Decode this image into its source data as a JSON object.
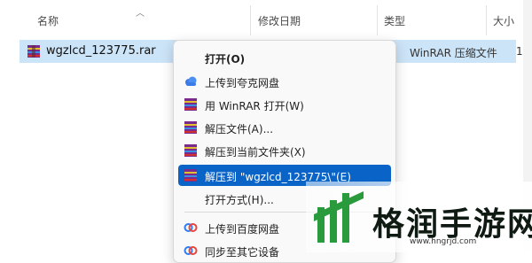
{
  "header": {
    "columns": [
      "名称",
      "修改日期",
      "类型",
      "大小"
    ]
  },
  "file": {
    "name": "wgzlcd_123775.rar",
    "type": "WinRAR 压缩文件",
    "size_fragment": "1"
  },
  "context_menu": {
    "items": [
      {
        "label": "打开(O)",
        "icon": "none"
      },
      {
        "label": "上传到夸克网盘",
        "icon": "cloud-icon"
      },
      {
        "label": "用 WinRAR 打开(W)",
        "icon": "winrar-icon"
      },
      {
        "label": "解压文件(A)...",
        "icon": "winrar-icon"
      },
      {
        "label": "解压到当前文件夹(X)",
        "icon": "winrar-icon"
      },
      {
        "label": "解压到 \"wgzlcd_123775\\\"(E)",
        "icon": "winrar-icon",
        "highlighted": true
      },
      {
        "label": "打开方式(H)...",
        "icon": "none"
      },
      {
        "label": "上传到百度网盘",
        "icon": "baidu-cloud-icon"
      },
      {
        "label": "同步至其它设备",
        "icon": "sync-icon"
      }
    ]
  },
  "watermark": {
    "title": "格润手游网",
    "url": "www.hngrjd.com"
  },
  "colors": {
    "selection": "#0a64c8",
    "file_row_selected": "#cce4f7",
    "brand_green": "#2a9b3c"
  }
}
